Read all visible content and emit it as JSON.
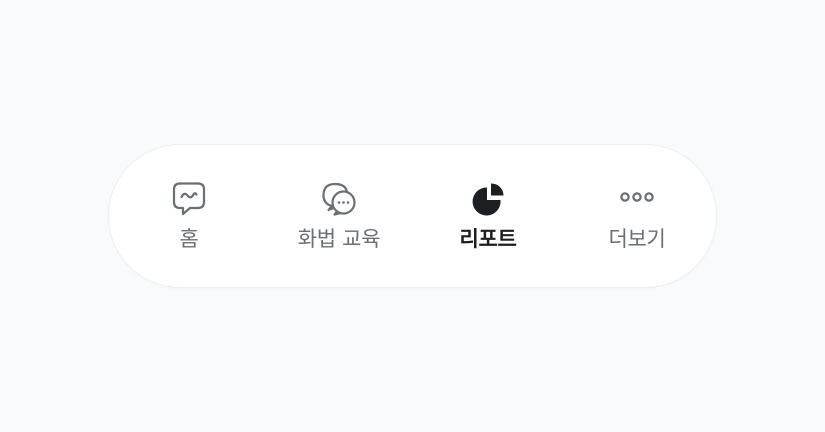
{
  "tabbar": {
    "colors": {
      "inactive": "#6b6e75",
      "active": "#1d1e21",
      "background": "#ffffff",
      "page": "#f9fafb"
    },
    "tabs": [
      {
        "label": "홈",
        "icon": "chat-wave-icon",
        "active": false
      },
      {
        "label": "화법 교육",
        "icon": "chat-bubbles-icon",
        "active": false
      },
      {
        "label": "리포트",
        "icon": "pie-chart-icon",
        "active": true
      },
      {
        "label": "더보기",
        "icon": "more-dots-icon",
        "active": false
      }
    ]
  }
}
